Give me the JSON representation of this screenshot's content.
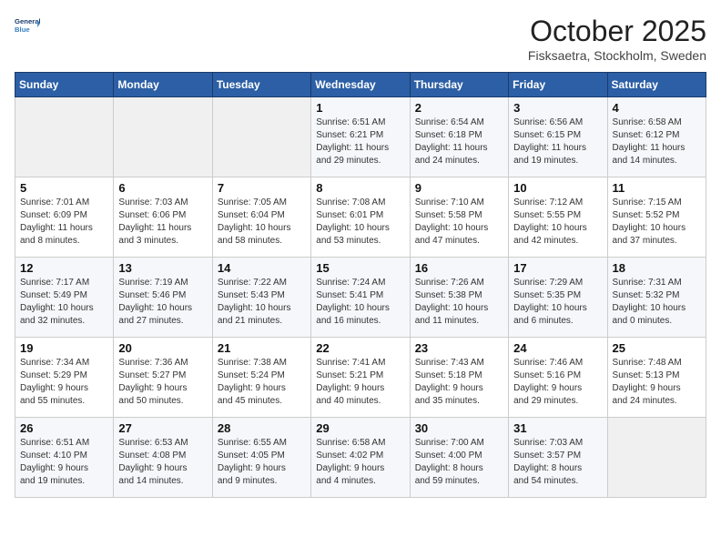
{
  "logo": {
    "line1": "General",
    "line2": "Blue"
  },
  "title": "October 2025",
  "subtitle": "Fisksaetra, Stockholm, Sweden",
  "days_of_week": [
    "Sunday",
    "Monday",
    "Tuesday",
    "Wednesday",
    "Thursday",
    "Friday",
    "Saturday"
  ],
  "weeks": [
    [
      {
        "day": "",
        "content": ""
      },
      {
        "day": "",
        "content": ""
      },
      {
        "day": "",
        "content": ""
      },
      {
        "day": "1",
        "content": "Sunrise: 6:51 AM\nSunset: 6:21 PM\nDaylight: 11 hours\nand 29 minutes."
      },
      {
        "day": "2",
        "content": "Sunrise: 6:54 AM\nSunset: 6:18 PM\nDaylight: 11 hours\nand 24 minutes."
      },
      {
        "day": "3",
        "content": "Sunrise: 6:56 AM\nSunset: 6:15 PM\nDaylight: 11 hours\nand 19 minutes."
      },
      {
        "day": "4",
        "content": "Sunrise: 6:58 AM\nSunset: 6:12 PM\nDaylight: 11 hours\nand 14 minutes."
      }
    ],
    [
      {
        "day": "5",
        "content": "Sunrise: 7:01 AM\nSunset: 6:09 PM\nDaylight: 11 hours\nand 8 minutes."
      },
      {
        "day": "6",
        "content": "Sunrise: 7:03 AM\nSunset: 6:06 PM\nDaylight: 11 hours\nand 3 minutes."
      },
      {
        "day": "7",
        "content": "Sunrise: 7:05 AM\nSunset: 6:04 PM\nDaylight: 10 hours\nand 58 minutes."
      },
      {
        "day": "8",
        "content": "Sunrise: 7:08 AM\nSunset: 6:01 PM\nDaylight: 10 hours\nand 53 minutes."
      },
      {
        "day": "9",
        "content": "Sunrise: 7:10 AM\nSunset: 5:58 PM\nDaylight: 10 hours\nand 47 minutes."
      },
      {
        "day": "10",
        "content": "Sunrise: 7:12 AM\nSunset: 5:55 PM\nDaylight: 10 hours\nand 42 minutes."
      },
      {
        "day": "11",
        "content": "Sunrise: 7:15 AM\nSunset: 5:52 PM\nDaylight: 10 hours\nand 37 minutes."
      }
    ],
    [
      {
        "day": "12",
        "content": "Sunrise: 7:17 AM\nSunset: 5:49 PM\nDaylight: 10 hours\nand 32 minutes."
      },
      {
        "day": "13",
        "content": "Sunrise: 7:19 AM\nSunset: 5:46 PM\nDaylight: 10 hours\nand 27 minutes."
      },
      {
        "day": "14",
        "content": "Sunrise: 7:22 AM\nSunset: 5:43 PM\nDaylight: 10 hours\nand 21 minutes."
      },
      {
        "day": "15",
        "content": "Sunrise: 7:24 AM\nSunset: 5:41 PM\nDaylight: 10 hours\nand 16 minutes."
      },
      {
        "day": "16",
        "content": "Sunrise: 7:26 AM\nSunset: 5:38 PM\nDaylight: 10 hours\nand 11 minutes."
      },
      {
        "day": "17",
        "content": "Sunrise: 7:29 AM\nSunset: 5:35 PM\nDaylight: 10 hours\nand 6 minutes."
      },
      {
        "day": "18",
        "content": "Sunrise: 7:31 AM\nSunset: 5:32 PM\nDaylight: 10 hours\nand 0 minutes."
      }
    ],
    [
      {
        "day": "19",
        "content": "Sunrise: 7:34 AM\nSunset: 5:29 PM\nDaylight: 9 hours\nand 55 minutes."
      },
      {
        "day": "20",
        "content": "Sunrise: 7:36 AM\nSunset: 5:27 PM\nDaylight: 9 hours\nand 50 minutes."
      },
      {
        "day": "21",
        "content": "Sunrise: 7:38 AM\nSunset: 5:24 PM\nDaylight: 9 hours\nand 45 minutes."
      },
      {
        "day": "22",
        "content": "Sunrise: 7:41 AM\nSunset: 5:21 PM\nDaylight: 9 hours\nand 40 minutes."
      },
      {
        "day": "23",
        "content": "Sunrise: 7:43 AM\nSunset: 5:18 PM\nDaylight: 9 hours\nand 35 minutes."
      },
      {
        "day": "24",
        "content": "Sunrise: 7:46 AM\nSunset: 5:16 PM\nDaylight: 9 hours\nand 29 minutes."
      },
      {
        "day": "25",
        "content": "Sunrise: 7:48 AM\nSunset: 5:13 PM\nDaylight: 9 hours\nand 24 minutes."
      }
    ],
    [
      {
        "day": "26",
        "content": "Sunrise: 6:51 AM\nSunset: 4:10 PM\nDaylight: 9 hours\nand 19 minutes."
      },
      {
        "day": "27",
        "content": "Sunrise: 6:53 AM\nSunset: 4:08 PM\nDaylight: 9 hours\nand 14 minutes."
      },
      {
        "day": "28",
        "content": "Sunrise: 6:55 AM\nSunset: 4:05 PM\nDaylight: 9 hours\nand 9 minutes."
      },
      {
        "day": "29",
        "content": "Sunrise: 6:58 AM\nSunset: 4:02 PM\nDaylight: 9 hours\nand 4 minutes."
      },
      {
        "day": "30",
        "content": "Sunrise: 7:00 AM\nSunset: 4:00 PM\nDaylight: 8 hours\nand 59 minutes."
      },
      {
        "day": "31",
        "content": "Sunrise: 7:03 AM\nSunset: 3:57 PM\nDaylight: 8 hours\nand 54 minutes."
      },
      {
        "day": "",
        "content": ""
      }
    ]
  ]
}
